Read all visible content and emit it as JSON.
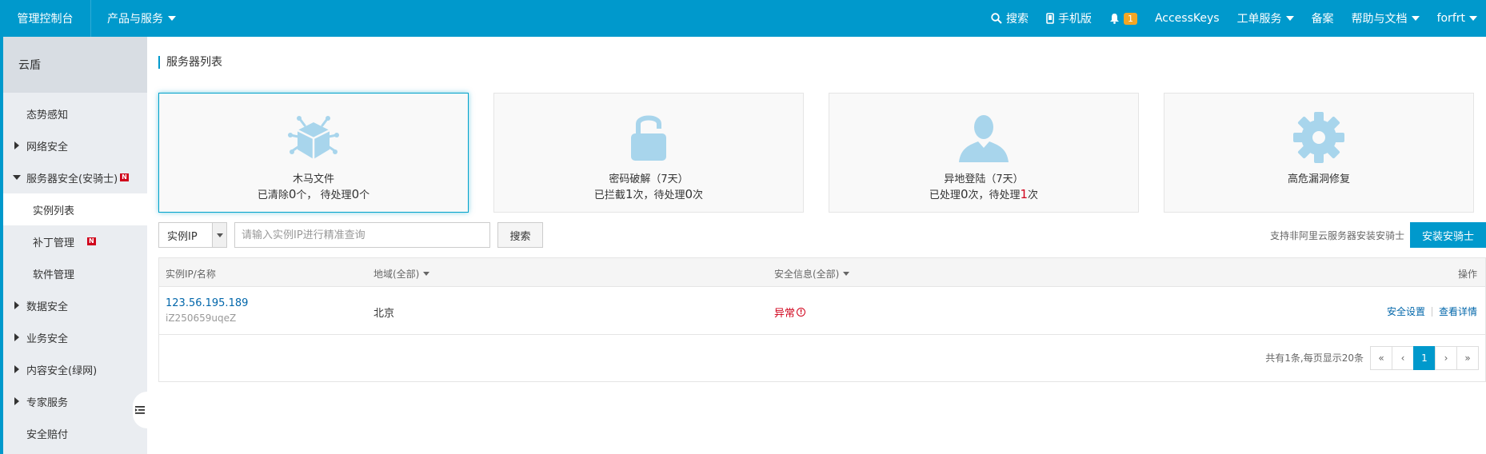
{
  "topbar": {
    "brand": "管理控制台",
    "products": "产品与服务",
    "search": "搜索",
    "mobile": "手机版",
    "notify_count": "1",
    "accesskeys": "AccessKeys",
    "tickets": "工单服务",
    "beian": "备案",
    "help": "帮助与文档",
    "user": "forfrt"
  },
  "sidebar": {
    "title": "云盾",
    "items": [
      {
        "label": "态势感知"
      },
      {
        "label": "网络安全"
      },
      {
        "label": "服务器安全(安骑士)",
        "badge": "N"
      },
      {
        "label": "实例列表"
      },
      {
        "label": "补丁管理",
        "badge": "N"
      },
      {
        "label": "软件管理"
      },
      {
        "label": "数据安全"
      },
      {
        "label": "业务安全"
      },
      {
        "label": "内容安全(绿网)"
      },
      {
        "label": "专家服务"
      },
      {
        "label": "安全赔付"
      }
    ]
  },
  "main": {
    "title": "服务器列表",
    "cards": [
      {
        "icon": "trojan-bug-icon",
        "name": "木马文件",
        "p1": "已清除",
        "n1": "0",
        "p2": "个， 待处理",
        "n2": "0",
        "p3": "个"
      },
      {
        "icon": "lock-icon",
        "name": "密码破解（7天）",
        "p1": "已拦截",
        "n1": "1",
        "p2": "次，待处理",
        "n2": "0",
        "p3": "次"
      },
      {
        "icon": "user-icon",
        "name": "异地登陆（7天）",
        "p1": "已处理",
        "n1": "0",
        "p2": "次，待处理",
        "n2": "1",
        "p3": "次"
      },
      {
        "icon": "gear-icon",
        "name": "高危漏洞修复"
      }
    ],
    "search": {
      "select_value": "实例IP",
      "placeholder": "请输入实例IP进行精准查询",
      "button": "搜索",
      "support_text": "支持非阿里云服务器安装安骑士",
      "install_button": "安装安骑士"
    },
    "table": {
      "headers": {
        "instance": "实例IP/名称",
        "region": "地域(全部)",
        "security": "安全信息(全部)",
        "actions": "操作"
      },
      "rows": [
        {
          "ip": "123.56.195.189",
          "name": "iZ250659uqeZ",
          "region": "北京",
          "status": "异常",
          "action1": "安全设置",
          "action2": "查看详情"
        }
      ],
      "footer": {
        "count_text": "共有1条,每页显示20条",
        "first": "«",
        "prev": "‹",
        "page": "1",
        "next": "›",
        "last": "»"
      }
    }
  }
}
